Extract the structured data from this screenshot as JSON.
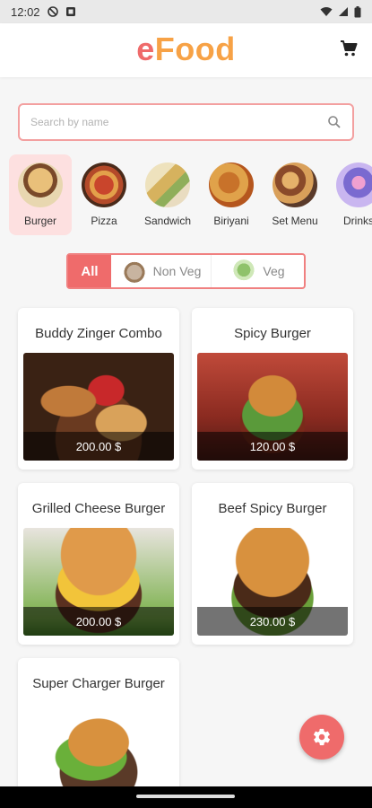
{
  "status_bar": {
    "time": "12:02"
  },
  "app": {
    "logo_first": "e",
    "logo_second": "Food"
  },
  "search": {
    "placeholder": "Search by name"
  },
  "categories": [
    {
      "label": "Burger",
      "active": true
    },
    {
      "label": "Pizza",
      "active": false
    },
    {
      "label": "Sandwich",
      "active": false
    },
    {
      "label": "Biriyani",
      "active": false
    },
    {
      "label": "Set Menu",
      "active": false
    },
    {
      "label": "Drinks",
      "active": false
    }
  ],
  "filter": {
    "all": "All",
    "non_veg": "Non Veg",
    "veg": "Veg",
    "selected": "All"
  },
  "products": [
    {
      "title": "Buddy Zinger Combo",
      "price": "200.00 $"
    },
    {
      "title": "Spicy Burger",
      "price": "120.00 $"
    },
    {
      "title": "Grilled Cheese Burger",
      "price": "200.00 $"
    },
    {
      "title": "Beef Spicy Burger",
      "price": "230.00 $"
    },
    {
      "title": "Super Charger Burger",
      "price": ""
    }
  ],
  "colors": {
    "accent": "#ef6b6b",
    "logo_orange": "#f7a246",
    "search_border": "#f3a0a0",
    "active_category_bg": "#fde0e0"
  },
  "icons": {
    "cart": "cart-icon",
    "search": "search-icon",
    "fab": "gear-icon"
  }
}
